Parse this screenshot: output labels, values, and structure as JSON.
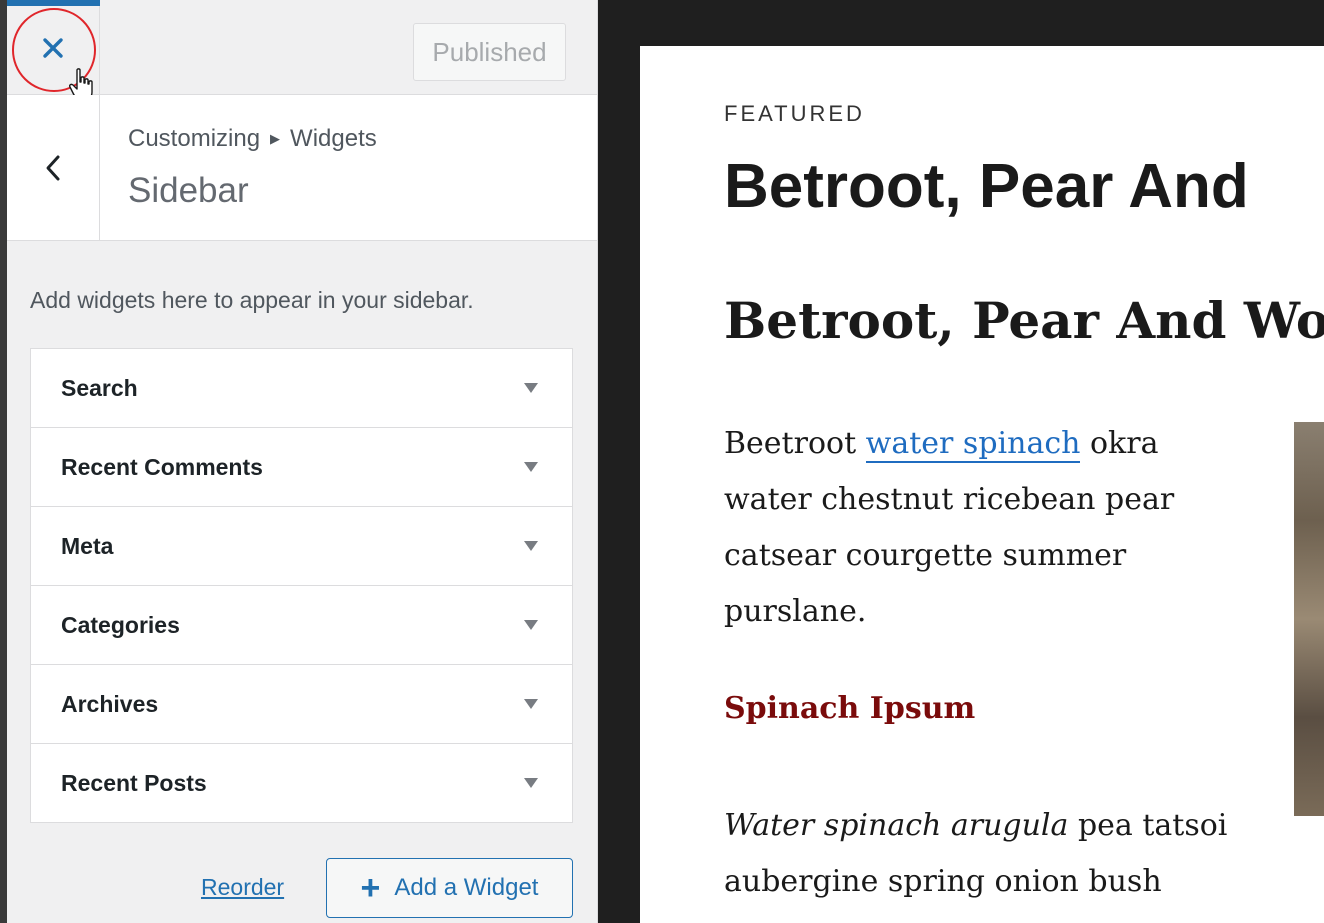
{
  "topbar": {
    "close_label": "Close",
    "publish_label": "Published"
  },
  "section": {
    "breadcrumb_root": "Customizing",
    "breadcrumb_current": "Widgets",
    "title": "Sidebar",
    "back_label": "Back"
  },
  "sidebar": {
    "description": "Add widgets here to appear in your sidebar.",
    "widgets": [
      {
        "title": "Search"
      },
      {
        "title": "Recent Comments"
      },
      {
        "title": "Meta"
      },
      {
        "title": "Categories"
      },
      {
        "title": "Archives"
      },
      {
        "title": "Recent Posts"
      }
    ],
    "reorder_label": "Reorder",
    "add_widget_label": "Add a Widget"
  },
  "preview": {
    "category": "FEATURED",
    "big_title": "Betroot, Pear And",
    "post_title": "Betroot, Pear And Wo",
    "para1_start": "Beetroot ",
    "para1_link": "water spinach",
    "para1_rest": " okra water chestnut ricebean pear catsear courgette summer purslane.",
    "subheading": "Spinach Ipsum",
    "para2_italic": "Water spinach arugula",
    "para2_rest": " pea tatsoi aubergine spring onion bush"
  },
  "colors": {
    "accent": "#2271b1",
    "highlight_ring": "#e0262b",
    "subheading": "#7a0b0b",
    "link": "#1f6cc0"
  }
}
